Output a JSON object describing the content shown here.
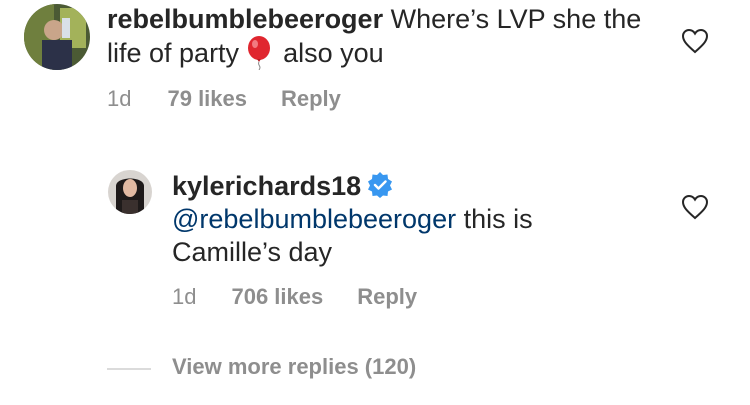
{
  "comments": [
    {
      "username": "rebelbumblebeeroger",
      "text_before_emoji": "Where’s LVP she the life of party",
      "emoji": "balloon-emoji",
      "text_after_emoji": "also you",
      "time": "1d",
      "likes": "79 likes",
      "reply_label": "Reply"
    }
  ],
  "replies": [
    {
      "username": "kylerichards18",
      "verified": true,
      "mention": "@rebelbumblebeeroger",
      "text": "this is Camille’s day",
      "time": "1d",
      "likes": "706 likes",
      "reply_label": "Reply"
    }
  ],
  "view_more_label": "View more replies (120)",
  "colors": {
    "text": "#262626",
    "secondary": "#8e8e8e",
    "mention": "#00376b",
    "verified_badge": "#3897f0",
    "balloon": "#e0262f"
  }
}
